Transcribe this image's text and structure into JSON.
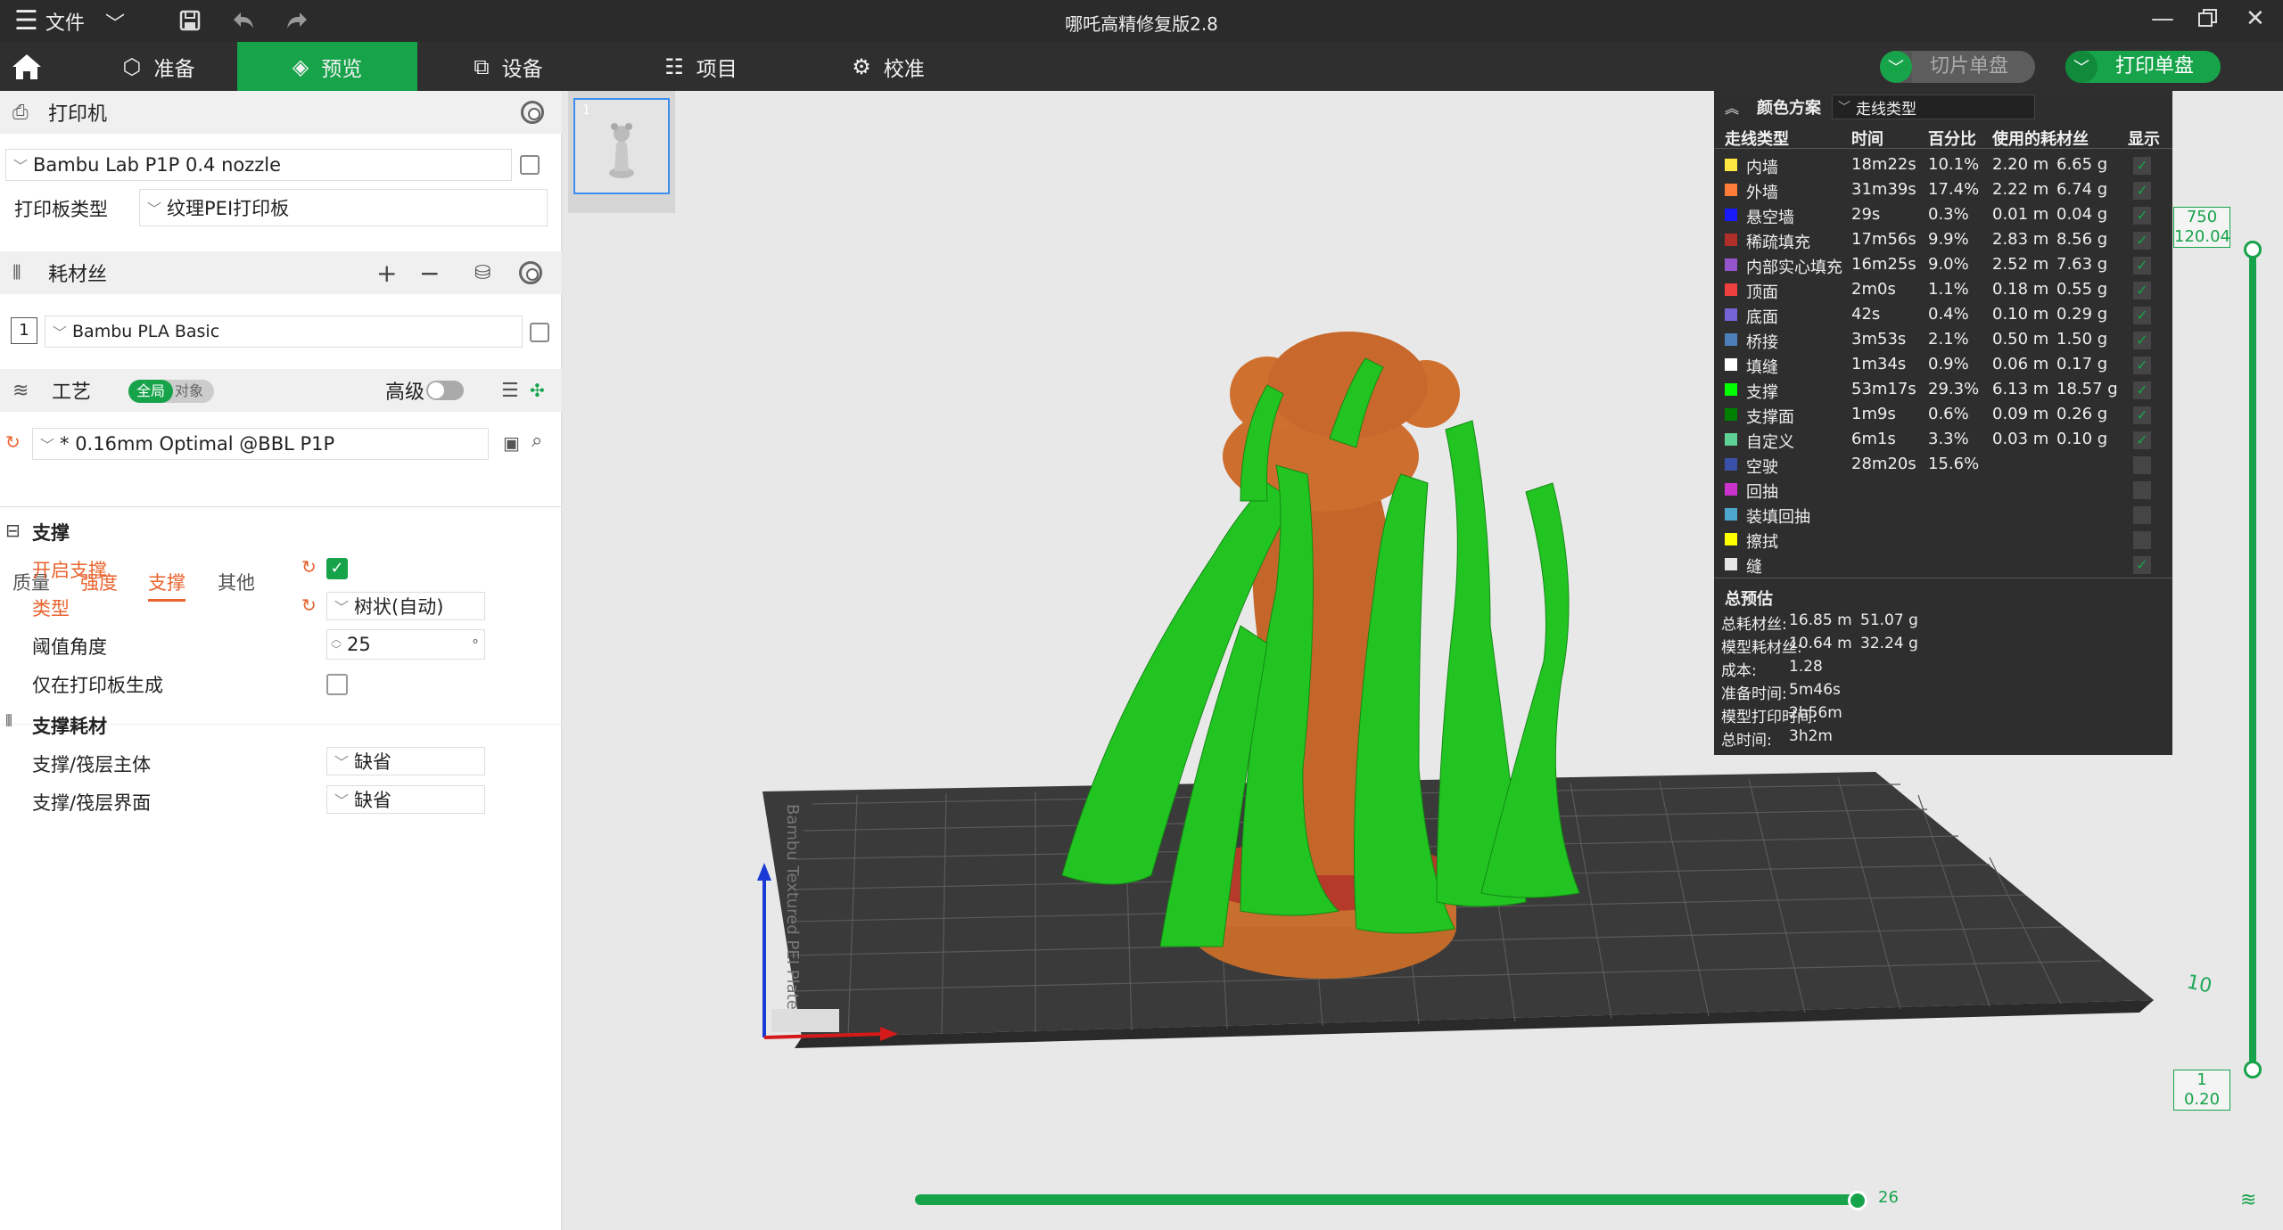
{
  "titlebar": {
    "menu_label": "文件",
    "title": "哪吒高精修复版2.8"
  },
  "nav": {
    "tabs": [
      {
        "label": "准备"
      },
      {
        "label": "预览"
      },
      {
        "label": "设备"
      },
      {
        "label": "项目"
      },
      {
        "label": "校准"
      }
    ],
    "slice_label": "切片单盘",
    "print_label": "打印单盘"
  },
  "printer": {
    "section_title": "打印机",
    "preset": "Bambu Lab P1P 0.4 nozzle",
    "plate_type_label": "打印板类型",
    "plate_type": "纹理PEI打印板"
  },
  "filament": {
    "section_title": "耗材丝",
    "items": [
      {
        "index": "1",
        "name": "Bambu PLA Basic"
      }
    ]
  },
  "process": {
    "section_title": "工艺",
    "toggle_global": "全局",
    "toggle_object": "对象",
    "advanced_label": "高级",
    "preset": "* 0.16mm Optimal @BBL P1P",
    "tabs": [
      "质量",
      "强度",
      "支撑",
      "其他"
    ],
    "support_group": "支撑",
    "enable_support_label": "开启支撑",
    "type_label": "类型",
    "type_value": "树状(自动)",
    "threshold_label": "阈值角度",
    "threshold_value": "25",
    "threshold_unit": "°",
    "build_plate_only_label": "仅在打印板生成",
    "support_filament_group": "支撑耗材",
    "base_label": "支撑/筏层主体",
    "base_value": "缺省",
    "interface_label": "支撑/筏层界面",
    "interface_value": "缺省"
  },
  "thumbnail": {
    "index": "1"
  },
  "legend": {
    "scheme_label": "颜色方案",
    "scheme_value": "走线类型",
    "headers": [
      "走线类型",
      "时间",
      "百分比",
      "使用的耗材丝",
      "显示"
    ],
    "rows": [
      {
        "name": "内墙",
        "color": "#ffe640",
        "time": "18m22s",
        "pct": "10.1%",
        "len": "2.20 m",
        "wt": "6.65 g",
        "show": true
      },
      {
        "name": "外墙",
        "color": "#ff7d38",
        "time": "31m39s",
        "pct": "17.4%",
        "len": "2.22 m",
        "wt": "6.74 g",
        "show": true
      },
      {
        "name": "悬空墙",
        "color": "#1a1aff",
        "time": "29s",
        "pct": "0.3%",
        "len": "0.01 m",
        "wt": "0.04 g",
        "show": true
      },
      {
        "name": "稀疏填充",
        "color": "#b03029",
        "time": "17m56s",
        "pct": "9.9%",
        "len": "2.83 m",
        "wt": "8.56 g",
        "show": true
      },
      {
        "name": "内部实心填充",
        "color": "#9654cc",
        "time": "16m25s",
        "pct": "9.0%",
        "len": "2.52 m",
        "wt": "7.63 g",
        "show": true
      },
      {
        "name": "顶面",
        "color": "#f04040",
        "time": "2m0s",
        "pct": "1.1%",
        "len": "0.18 m",
        "wt": "0.55 g",
        "show": true
      },
      {
        "name": "底面",
        "color": "#7464d6",
        "time": "42s",
        "pct": "0.4%",
        "len": "0.10 m",
        "wt": "0.29 g",
        "show": true
      },
      {
        "name": "桥接",
        "color": "#4d80ba",
        "time": "3m53s",
        "pct": "2.1%",
        "len": "0.50 m",
        "wt": "1.50 g",
        "show": true
      },
      {
        "name": "填缝",
        "color": "#ffffff",
        "time": "1m34s",
        "pct": "0.9%",
        "len": "0.06 m",
        "wt": "0.17 g",
        "show": true
      },
      {
        "name": "支撑",
        "color": "#00ff00",
        "time": "53m17s",
        "pct": "29.3%",
        "len": "6.13 m",
        "wt": "18.57 g",
        "show": true
      },
      {
        "name": "支撑面",
        "color": "#008000",
        "time": "1m9s",
        "pct": "0.6%",
        "len": "0.09 m",
        "wt": "0.26 g",
        "show": true
      },
      {
        "name": "自定义",
        "color": "#5ed194",
        "time": "6m1s",
        "pct": "3.3%",
        "len": "0.03 m",
        "wt": "0.10 g",
        "show": true
      },
      {
        "name": "空驶",
        "color": "#3850a8",
        "time": "28m20s",
        "pct": "15.6%",
        "len": "",
        "wt": "",
        "show": false
      },
      {
        "name": "回抽",
        "color": "#cc33cc",
        "time": "",
        "pct": "",
        "len": "",
        "wt": "",
        "show": false
      },
      {
        "name": "装填回抽",
        "color": "#4da6cc",
        "time": "",
        "pct": "",
        "len": "",
        "wt": "",
        "show": false
      },
      {
        "name": "擦拭",
        "color": "#ffff00",
        "time": "",
        "pct": "",
        "len": "",
        "wt": "",
        "show": false
      },
      {
        "name": "缝",
        "color": "#e6e6e6",
        "time": "",
        "pct": "",
        "len": "",
        "wt": "",
        "show": true
      }
    ],
    "estimate_title": "总预估",
    "estimates": [
      {
        "label": "总耗材丝:",
        "v1": "16.85 m",
        "v2": "51.07 g"
      },
      {
        "label": "模型耗材丝:",
        "v1": "10.64 m",
        "v2": "32.24 g"
      },
      {
        "label": "成本:",
        "v1": "1.28",
        "v2": ""
      },
      {
        "label": "准备时间:",
        "v1": "5m46s",
        "v2": ""
      },
      {
        "label": "模型打印时间:",
        "v1": "2h56m",
        "v2": ""
      },
      {
        "label": "总时间:",
        "v1": "3h2m",
        "v2": ""
      }
    ]
  },
  "layer_slider": {
    "top_layer": "750",
    "top_height": "120.04",
    "bottom_layer": "1",
    "bottom_height": "0.20",
    "move_value": "26"
  }
}
